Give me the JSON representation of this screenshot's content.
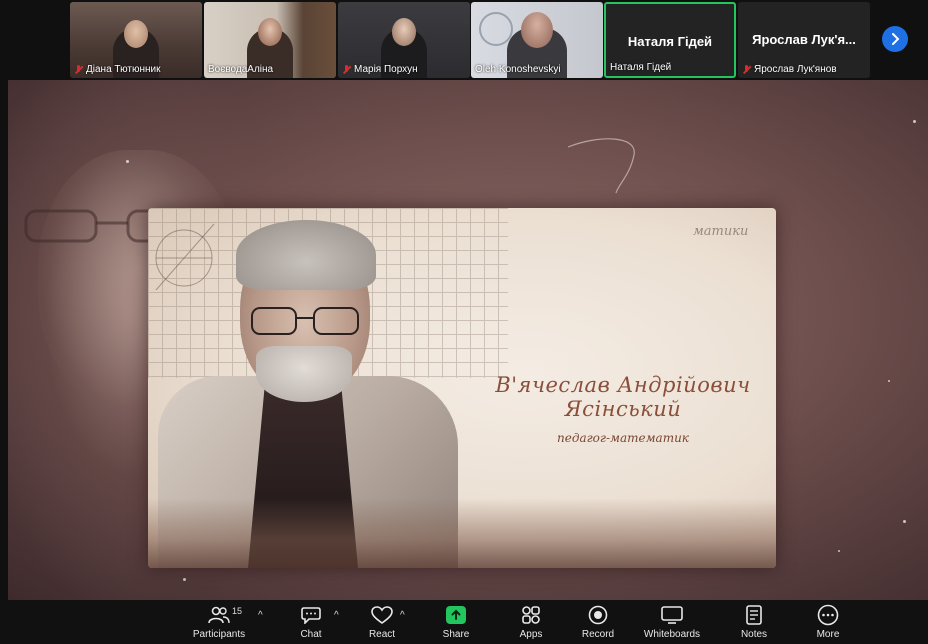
{
  "participants": [
    {
      "name": "Діана Тютюнник",
      "muted": true
    },
    {
      "name": "ВоєводаАліна",
      "muted": false
    },
    {
      "name": "Марія Порхун",
      "muted": true
    },
    {
      "name": "Oleh Konoshevskyi",
      "muted": false
    },
    {
      "name": "Наталя Гідей",
      "display": "Наталя Гідей",
      "muted": false,
      "active": true
    },
    {
      "name": "Ярослав Лук'янов",
      "display": "Ярослав Лук'я...",
      "muted": true
    }
  ],
  "shared_content": {
    "name_line1": "В'ячеслав Андрійович",
    "name_line2": "Ясінський",
    "subtitle": "педагог-математик",
    "paper_text": "матики"
  },
  "toolbar": {
    "participants_label": "Participants",
    "participants_count": "15",
    "chat_label": "Chat",
    "react_label": "React",
    "share_label": "Share",
    "apps_label": "Apps",
    "record_label": "Record",
    "whiteboards_label": "Whiteboards",
    "notes_label": "Notes",
    "more_label": "More"
  },
  "colors": {
    "accent_green": "#22c55e",
    "next_button": "#1f6fe5",
    "mute_red": "#e02828",
    "caption": "#8a4f3a"
  }
}
